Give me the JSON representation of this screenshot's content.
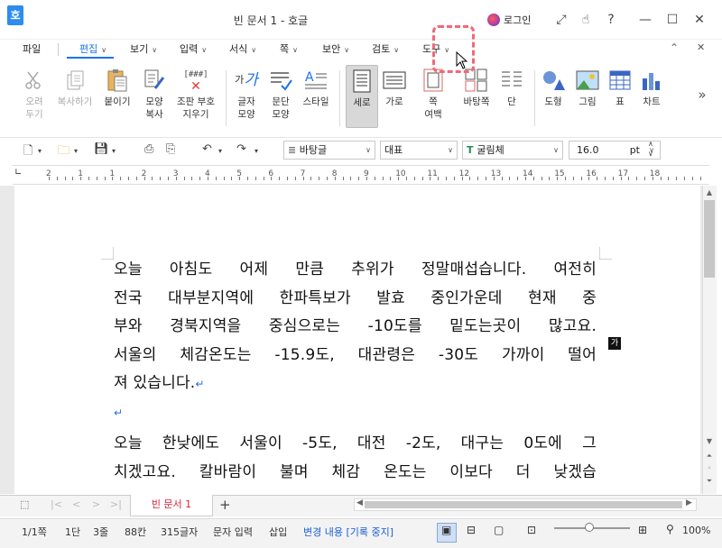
{
  "window": {
    "title": "빈 문서 1 - 호글",
    "app_icon": "호",
    "login": "로그인",
    "icons": [
      "login-icon",
      "fullscreen-icon",
      "hand-icon",
      "help-icon",
      "minimize-icon",
      "maximize-icon",
      "close-icon"
    ],
    "help_glyph": "?"
  },
  "menu": {
    "file": "파일",
    "items": [
      "편집",
      "보기",
      "입력",
      "서식",
      "쪽",
      "보안",
      "검토",
      "도구"
    ],
    "active": "편집",
    "pin_glyph": "⌃",
    "close_glyph": "✕"
  },
  "ribbon": {
    "cut": [
      "오려",
      "두기"
    ],
    "copy": "복사하기",
    "paste": "붙이기",
    "format_copy": [
      "모양",
      "복사"
    ],
    "symbol": [
      "조판 부호",
      "지우기"
    ],
    "symbol_glyph": "[###]",
    "char_shape": [
      "글자",
      "모양"
    ],
    "para_shape": [
      "문단",
      "모양"
    ],
    "style": "스타일",
    "portrait": "세로",
    "landscape": "가로",
    "page_margin": [
      "쪽",
      "여백"
    ],
    "background": "바탕쪽",
    "columns": "단",
    "shapes": "도형",
    "picture": "그림",
    "table": "표",
    "chart": "차트",
    "more_glyph": "»"
  },
  "format_toolbar": {
    "style_value": "바탕글",
    "lang_value": "대표",
    "font_value": "굴림체",
    "size_value": "16.0",
    "size_unit": "pt"
  },
  "ruler": {
    "numbers": [
      "2",
      "1",
      "1",
      "2",
      "3",
      "4",
      "5",
      "6",
      "7",
      "8",
      "9",
      "10",
      "11",
      "12",
      "13",
      "14",
      "15",
      "16",
      "17",
      "18"
    ]
  },
  "document": {
    "para1": [
      "오늘 아침도 어제 만큼 추위가 정말매섭습니다. 여전히",
      "전국 대부분지역에 한파특보가 발효 중인가운데 현재 중",
      "부와 경북지역을 중심으로는 -10도를 밑도는곳이 많고요.",
      "서울의 체감온도는 -15.9도, 대관령은 -30도 가까이 떨어",
      "져 있습니다."
    ],
    "para2": [
      "오늘 한낮에도 서울이 -5도, 대전 -2도, 대구는 0도에 그",
      "치겠고요. 칼바람이 불며 체감 온도는 이보다 더 낮겠습"
    ],
    "para_mark": "↵",
    "badge": "가"
  },
  "tabs": {
    "doc_tab": "빈 문서 1",
    "add": "+"
  },
  "status": {
    "page": "1/1쪽",
    "column": "1단",
    "line": "3줄",
    "col": "88칸",
    "chars": "315글자",
    "mode": "문자 입력",
    "insert": "삽입",
    "track": "변경 내용 [기록 중지]",
    "zoom": "100%"
  },
  "colors": {
    "accent": "#1a73e8",
    "highlight": "#ef6a78",
    "tab_text": "#d22233"
  }
}
